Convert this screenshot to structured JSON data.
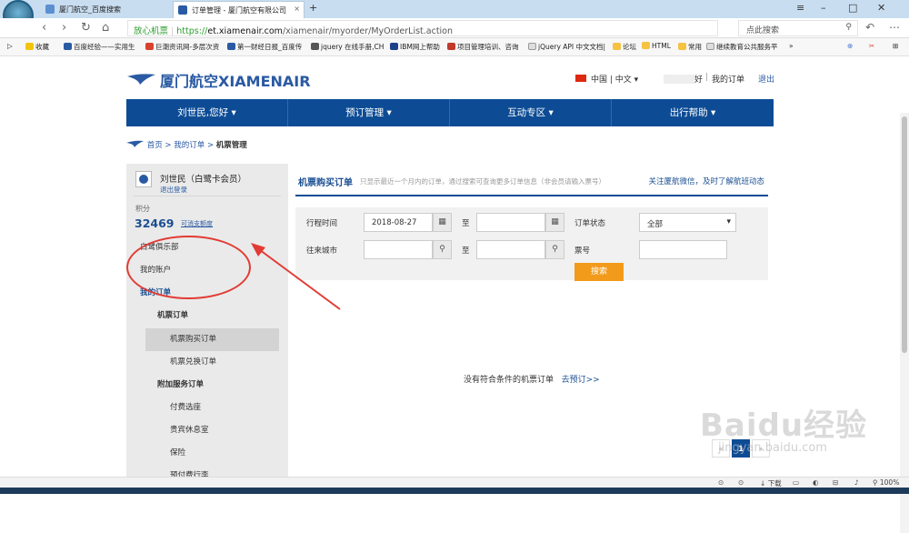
{
  "browser": {
    "tabs": [
      {
        "label": "厦门航空_百度搜索"
      },
      {
        "label": "订单管理 - 厦门航空有限公司"
      }
    ],
    "url": {
      "safe_label": "放心机票",
      "scheme": "https://",
      "domain": "et.xiamenair.com",
      "path": "/xiamenair/myorder/MyOrderList.action"
    },
    "search_placeholder": "点此搜索",
    "bookmarks": [
      "收藏",
      "百度经验——实用生",
      "巨潮资讯网-多层次资",
      "第一财经日报_百度传",
      "jquery 在线手册,CH",
      "IBM网上帮助",
      "项目管理培训、咨询",
      "jQuery API 中文文档|",
      "论坛",
      "HTML",
      "常用",
      "继续教育公共服务平"
    ],
    "bookmarks_overflow": "»"
  },
  "site": {
    "logo_text": "厦门航空XIAMENAIR",
    "language": "中国 | 中文",
    "greeting": "好",
    "my_orders_link": "我的订单",
    "logout_link": "退出",
    "nav": [
      "刘世民,您好",
      "预订管理",
      "互动专区",
      "出行帮助"
    ],
    "breadcrumb": {
      "home": "首页",
      "sep": ">",
      "orders": "我的订单",
      "current": "机票管理"
    }
  },
  "sidebar": {
    "user_name": "刘世民（白鹭卡会员）",
    "logout": "退出登录",
    "points_label": "积分",
    "points_value": "32469",
    "points_link": "可消支额度",
    "menu": [
      {
        "label": "白鹭俱乐部",
        "level": 1
      },
      {
        "label": "我的账户",
        "level": 1
      },
      {
        "label": "我的订单",
        "level": 1,
        "active": true
      },
      {
        "label": "机票订单",
        "level": 2
      },
      {
        "label": "机票购买订单",
        "level": 3,
        "selected": true
      },
      {
        "label": "机票兑换订单",
        "level": 3
      },
      {
        "label": "附加服务订单",
        "level": 2
      },
      {
        "label": "付费选座",
        "level": 3
      },
      {
        "label": "贵宾休息室",
        "level": 3
      },
      {
        "label": "保险",
        "level": 3
      },
      {
        "label": "预付费行李",
        "level": 3
      }
    ]
  },
  "panel": {
    "title": "机票购买订单",
    "note": "只显示最近一个月内的订单，通过搜索可查询更多订单信息（非会员请输入票号）",
    "follow_link": "关注厦航微信，及时了解航班动态",
    "form": {
      "travel_time_label": "行程时间",
      "date_from": "2018-08-27",
      "to_label": "至",
      "order_status_label": "订单状态",
      "order_status_value": "全部",
      "city_label": "往来城市",
      "ticket_no_label": "票号",
      "search_button": "搜索"
    },
    "empty_text": "没有符合条件的机票订单",
    "book_link": "去预订>>",
    "pager": {
      "prev": "«",
      "current": "1",
      "next": "»"
    }
  },
  "statusbar": {
    "items": [
      "下载",
      "100%"
    ]
  },
  "watermark": {
    "text": "Baidu经验",
    "sub": "jingyan.baidu.com"
  },
  "colors": {
    "brand_blue": "#0d4c95",
    "search_orange": "#f29b1a",
    "annotation_red": "#e23b34"
  }
}
